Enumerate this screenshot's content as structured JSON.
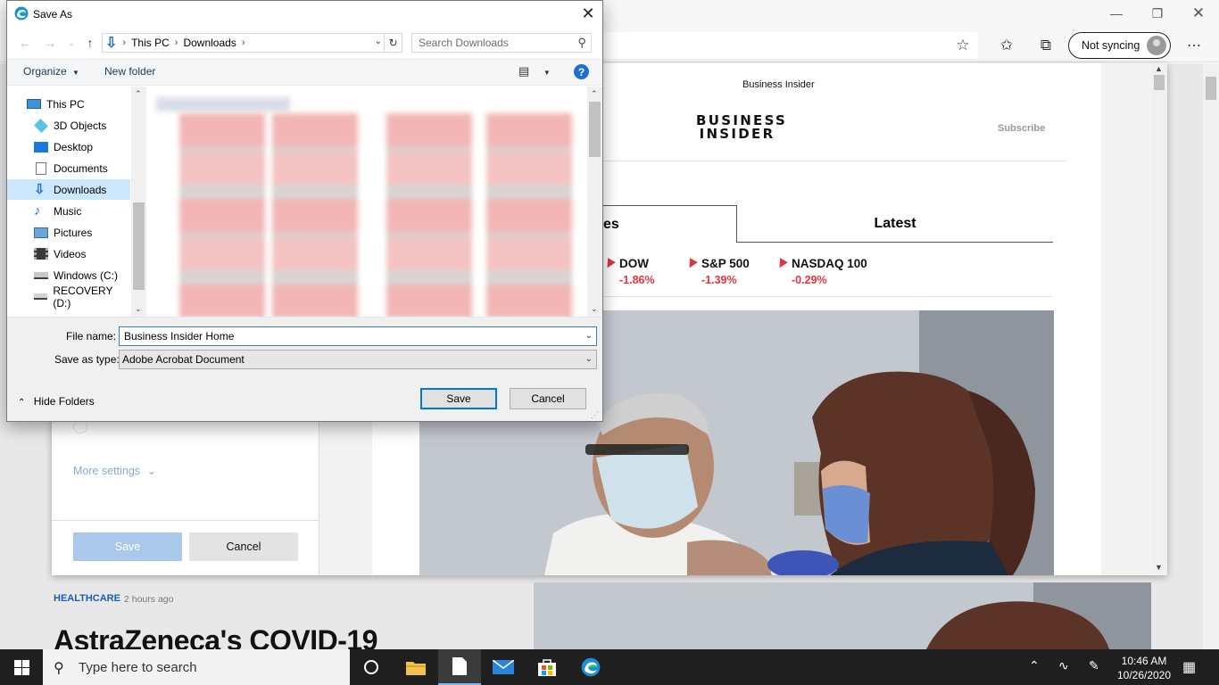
{
  "browser": {
    "sync_label": "Not syncing",
    "icons": [
      "favorite-star-icon",
      "favorites-icon",
      "collections-icon",
      "profile-avatar-icon",
      "more-icon"
    ]
  },
  "print_dialog": {
    "more_settings": "More settings",
    "save_label": "Save",
    "cancel_label": "Cancel"
  },
  "preview": {
    "site_small": "Business Insider",
    "logo_line1": "BUSINESS",
    "logo_line2": "INSIDER",
    "subscribe": "Subscribe",
    "tab_markets_fragment": "es",
    "tab_latest": "Latest",
    "tickers": [
      {
        "name": "DOW",
        "change": "-1.86%"
      },
      {
        "name": "S&P 500",
        "change": "-1.39%"
      },
      {
        "name": "NASDAQ 100",
        "change": "-0.29%"
      }
    ]
  },
  "article": {
    "category": "HEALTHCARE",
    "age": "2 hours ago",
    "headline": "AstraZeneca's COVID-19"
  },
  "dialog": {
    "title": "Save As",
    "path": [
      "This PC",
      "Downloads"
    ],
    "search_placeholder": "Search Downloads",
    "organize": "Organize",
    "new_folder": "New folder",
    "nav_items": [
      {
        "label": "This PC",
        "icon": "computer-icon"
      },
      {
        "label": "3D Objects",
        "icon": "3d-objects-icon"
      },
      {
        "label": "Desktop",
        "icon": "desktop-icon"
      },
      {
        "label": "Documents",
        "icon": "documents-icon"
      },
      {
        "label": "Downloads",
        "icon": "downloads-icon",
        "selected": true
      },
      {
        "label": "Music",
        "icon": "music-icon"
      },
      {
        "label": "Pictures",
        "icon": "pictures-icon"
      },
      {
        "label": "Videos",
        "icon": "videos-icon"
      },
      {
        "label": "Windows (C:)",
        "icon": "drive-icon"
      },
      {
        "label": "RECOVERY (D:)",
        "icon": "drive-icon"
      }
    ],
    "file_name_label": "File name:",
    "file_name_value": "Business Insider Home",
    "save_type_label": "Save as type:",
    "save_type_value": "Adobe Acrobat Document",
    "hide_folders": "Hide Folders",
    "save_label": "Save",
    "cancel_label": "Cancel"
  },
  "taskbar": {
    "search_placeholder": "Type here to search",
    "time": "10:46 AM",
    "date": "10/26/2020"
  },
  "colors": {
    "accent": "#0078d7",
    "ticker_red": "#e0343e",
    "selection": "#cce8ff"
  }
}
